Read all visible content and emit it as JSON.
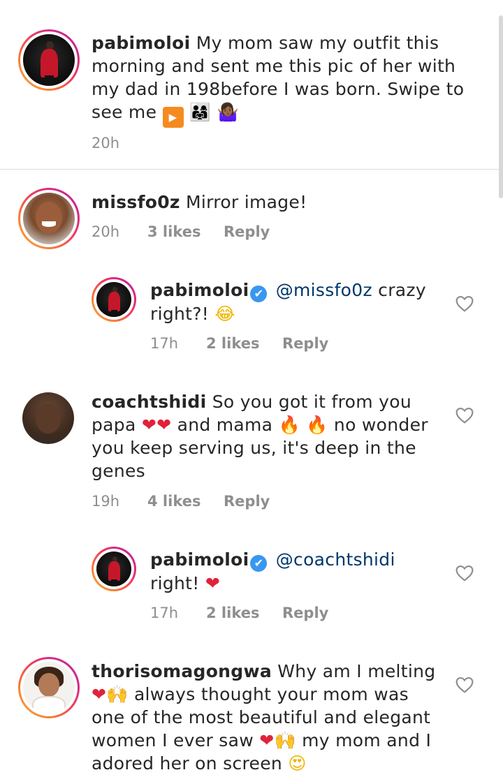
{
  "caption": {
    "username": "pabimoloi",
    "text": "My mom saw my outfit this morning and sent me this pic of her with my dad in 198before I was born. Swipe to see me",
    "emojis": [
      "▶",
      "👨‍👩‍👧",
      "🤷🏾‍♀️"
    ],
    "time": "20h"
  },
  "comments": [
    {
      "username": "missfo0z",
      "text": "Mirror image!",
      "time": "20h",
      "likes": "3 likes",
      "reply_label": "Reply",
      "avatar": "missfo0z-avatar",
      "replies": [
        {
          "username": "pabimoloi",
          "verified_icon": "✔",
          "mention": "@missfo0z",
          "text": "crazy right?!",
          "emoji": "😂",
          "time": "17h",
          "likes": "2 likes",
          "reply_label": "Reply"
        }
      ]
    },
    {
      "username": "coachtshidi",
      "text_1": "So you got it from you papa",
      "hearts": "❤❤",
      "text_2": "and mama",
      "fires": "🔥 🔥",
      "text_3": "no wonder you keep serving us, it's deep in the genes",
      "time": "19h",
      "likes": "4 likes",
      "reply_label": "Reply",
      "replies": [
        {
          "username": "pabimoloi",
          "verified_icon": "✔",
          "mention": "@coachtshidi",
          "text": "right!",
          "emoji": "❤",
          "time": "17h",
          "likes": "2 likes",
          "reply_label": "Reply"
        }
      ]
    },
    {
      "username": "thorisomagongwa",
      "text_1": "Why am I melting",
      "emoji_1": "❤🙌",
      "text_2": "always thought your mom was one of the most beautiful and elegant women I ever saw",
      "emoji_2": "❤🙌",
      "text_3": "my mom and I adored her on screen",
      "emoji_3": "😍"
    }
  ],
  "icons": {
    "like": "heart-outline-icon",
    "verified": "verified-badge-icon"
  },
  "colors": {
    "text": "#262626",
    "meta": "#8e8e8e",
    "mention": "#00376b",
    "verified": "#3897f0",
    "divider": "#dbdbdb"
  }
}
